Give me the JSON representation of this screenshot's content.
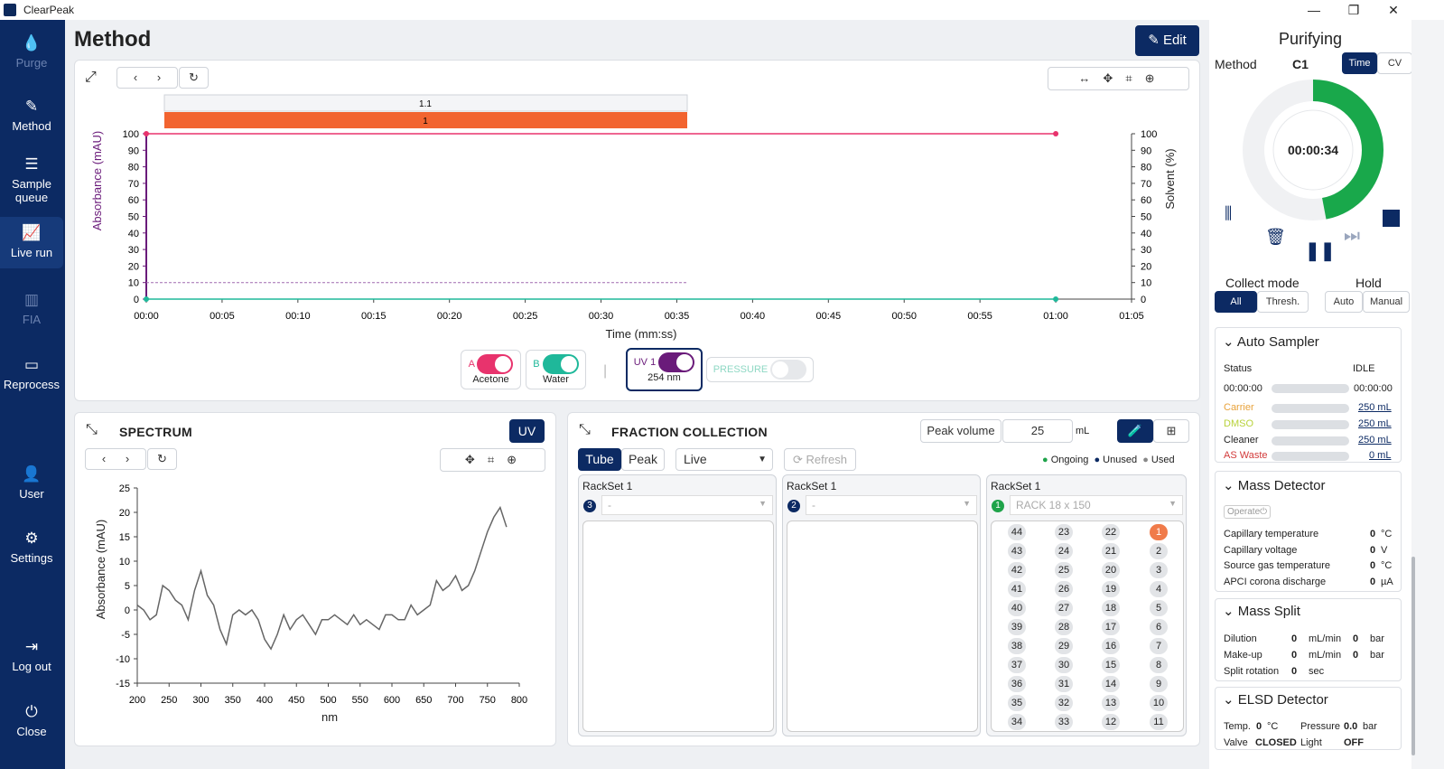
{
  "app": {
    "title": "ClearPeak"
  },
  "sidebar": {
    "items": [
      {
        "label": "Purge"
      },
      {
        "label": "Method"
      },
      {
        "label": "Sample\nqueue"
      },
      {
        "label": "Live run"
      },
      {
        "label": "FIA"
      },
      {
        "label": "Reprocess"
      },
      {
        "label": "User"
      },
      {
        "label": "Settings"
      },
      {
        "label": "Log out"
      },
      {
        "label": "Close"
      }
    ]
  },
  "header": {
    "title": "Method",
    "edit_label": "Edit"
  },
  "main_chart": {
    "fraction_labels": [
      "1.1",
      "1"
    ],
    "left_axis_label": "Absorbance (mAU)",
    "right_axis_label": "Solvent (%)",
    "x_axis_label": "Time (mm:ss)",
    "y_ticks": [
      "100",
      "90",
      "80",
      "70",
      "60",
      "50",
      "40",
      "30",
      "20",
      "10",
      "0"
    ],
    "x_ticks": [
      "00:00",
      "00:05",
      "00:10",
      "00:15",
      "00:20",
      "00:25",
      "00:30",
      "00:35",
      "00:40",
      "00:45",
      "00:50",
      "00:55",
      "01:00",
      "01:05"
    ]
  },
  "legend": {
    "a_letter": "A",
    "a_label": "Acetone",
    "b_letter": "B",
    "b_label": "Water",
    "uv_letter": "UV 1",
    "uv_label": "254 nm",
    "pressure_label": "PRESSURE"
  },
  "spectrum": {
    "title": "SPECTRUM",
    "uv_button": "UV",
    "ylabel": "Absorbance (mAU)",
    "xlabel": "nm"
  },
  "fraction": {
    "title": "FRACTION COLLECTION",
    "peak_volume_label": "Peak volume",
    "peak_volume_value": "25",
    "unit": "mL",
    "tab_tube": "Tube",
    "tab_peak": "Peak",
    "mode": "Live",
    "refresh": "Refresh",
    "legend_ongoing": "Ongoing",
    "legend_unused": "Unused",
    "legend_used": "Used",
    "racks": [
      {
        "title": "RackSet 1",
        "badge": "3",
        "select": "-"
      },
      {
        "title": "RackSet 1",
        "badge": "2",
        "select": "-"
      },
      {
        "title": "RackSet 1",
        "badge": "1",
        "select": "RACK 18 x 150"
      }
    ],
    "tube_columns": [
      [
        "44",
        "43",
        "42",
        "41",
        "40",
        "39",
        "38",
        "37",
        "36",
        "35",
        "34"
      ],
      [
        "23",
        "24",
        "25",
        "26",
        "27",
        "28",
        "29",
        "30",
        "31",
        "32",
        "33"
      ],
      [
        "22",
        "21",
        "20",
        "19",
        "18",
        "17",
        "16",
        "15",
        "14",
        "13",
        "12"
      ],
      [
        "1",
        "2",
        "3",
        "4",
        "5",
        "6",
        "7",
        "8",
        "9",
        "10",
        "11"
      ]
    ]
  },
  "status": {
    "title": "Purifying",
    "method_label": "Method",
    "method_value": "C1",
    "time_btn": "Time",
    "cv_btn": "CV",
    "timer": "00:00:34",
    "progress": 0.47,
    "collect_mode_label": "Collect mode",
    "collect_all": "All",
    "collect_thresh": "Thresh.",
    "hold_label": "Hold",
    "hold_auto": "Auto",
    "hold_manual": "Manual"
  },
  "auto_sampler": {
    "title": "Auto Sampler",
    "status_label": "Status",
    "status_value": "IDLE",
    "time_left": "00:00:00",
    "time_right": "00:00:00",
    "rows": [
      {
        "name": "Carrier",
        "value": "250 mL",
        "color": "#e8a23a"
      },
      {
        "name": "DMSO",
        "value": "250 mL",
        "color": "#b8d23a"
      },
      {
        "name": "Cleaner",
        "value": "250 mL",
        "color": "#222222"
      },
      {
        "name": "AS Waste",
        "value": "0 mL",
        "color": "#d23a3a"
      }
    ]
  },
  "mass_detector": {
    "title": "Mass Detector",
    "operate": "Operate",
    "rows": [
      {
        "name": "Capillary temperature",
        "value": "0",
        "unit": "°C"
      },
      {
        "name": "Capillary voltage",
        "value": "0",
        "unit": "V"
      },
      {
        "name": "Source gas temperature",
        "value": "0",
        "unit": "°C"
      },
      {
        "name": "APCI corona discharge",
        "value": "0",
        "unit": "µA"
      }
    ]
  },
  "mass_split": {
    "title": "Mass Split",
    "rows": [
      {
        "name": "Dilution",
        "v1": "0",
        "u1": "mL/min",
        "v2": "0",
        "u2": "bar"
      },
      {
        "name": "Make-up",
        "v1": "0",
        "u1": "mL/min",
        "v2": "0",
        "u2": "bar"
      },
      {
        "name": "Split rotation",
        "v1": "0",
        "u1": "sec",
        "v2": "",
        "u2": ""
      }
    ]
  },
  "elsd": {
    "title": "ELSD Detector",
    "temp_label": "Temp.",
    "temp_value": "0",
    "temp_unit": "°C",
    "pressure_label": "Pressure",
    "pressure_value": "0.0",
    "pressure_unit": "bar",
    "valve_label": "Valve",
    "valve_value": "CLOSED",
    "light_label": "Light",
    "light_value": "OFF"
  },
  "chart_data": [
    {
      "type": "line",
      "title": "",
      "xlabel": "Time (mm:ss)",
      "ylabel": "Absorbance (mAU)",
      "y2label": "Solvent (%)",
      "xlim": [
        "00:00",
        "01:05"
      ],
      "ylim": [
        0,
        100
      ],
      "series": [
        {
          "name": "Acetone",
          "x": [
            "00:00",
            "01:00"
          ],
          "values": [
            100,
            100
          ],
          "color": "#e8336d"
        },
        {
          "name": "Water",
          "x": [
            "00:00",
            "01:00"
          ],
          "values": [
            0,
            0
          ],
          "color": "#1fb89a"
        }
      ]
    },
    {
      "type": "line",
      "title": "",
      "xlabel": "nm",
      "ylabel": "Absorbance (mAU)",
      "xlim": [
        200,
        800
      ],
      "ylim": [
        -15,
        25
      ],
      "x_ticks": [
        200,
        250,
        300,
        350,
        400,
        450,
        500,
        550,
        600,
        650,
        700,
        750,
        800
      ],
      "y_ticks": [
        25,
        20,
        15,
        10,
        5,
        0,
        -5,
        -10,
        -15
      ],
      "series": [
        {
          "x": [
            200,
            210,
            220,
            230,
            240,
            250,
            260,
            270,
            280,
            290,
            300,
            310,
            320,
            330,
            340,
            350,
            360,
            370,
            380,
            390,
            400,
            410,
            420,
            430,
            440,
            450,
            460,
            470,
            480,
            490,
            500,
            510,
            520,
            530,
            540,
            550,
            560,
            570,
            580,
            590,
            600,
            610,
            620,
            630,
            640,
            650,
            660,
            670,
            680,
            690,
            700,
            710,
            720,
            730,
            740,
            750,
            760,
            770,
            780
          ],
          "values": [
            1,
            0,
            -2,
            -1,
            5,
            4,
            2,
            1,
            -2,
            4,
            8,
            3,
            1,
            -4,
            -7,
            -1,
            0,
            -1,
            0,
            -2,
            -6,
            -8,
            -5,
            -1,
            -4,
            -2,
            -1,
            -3,
            -5,
            -2,
            -2,
            -1,
            -2,
            -3,
            -1,
            -3,
            -2,
            -3,
            -4,
            -1,
            -1,
            -2,
            -2,
            1,
            -1,
            0,
            1,
            6,
            4,
            5,
            7,
            4,
            5,
            8,
            12,
            16,
            19,
            21,
            17
          ]
        }
      ]
    }
  ]
}
